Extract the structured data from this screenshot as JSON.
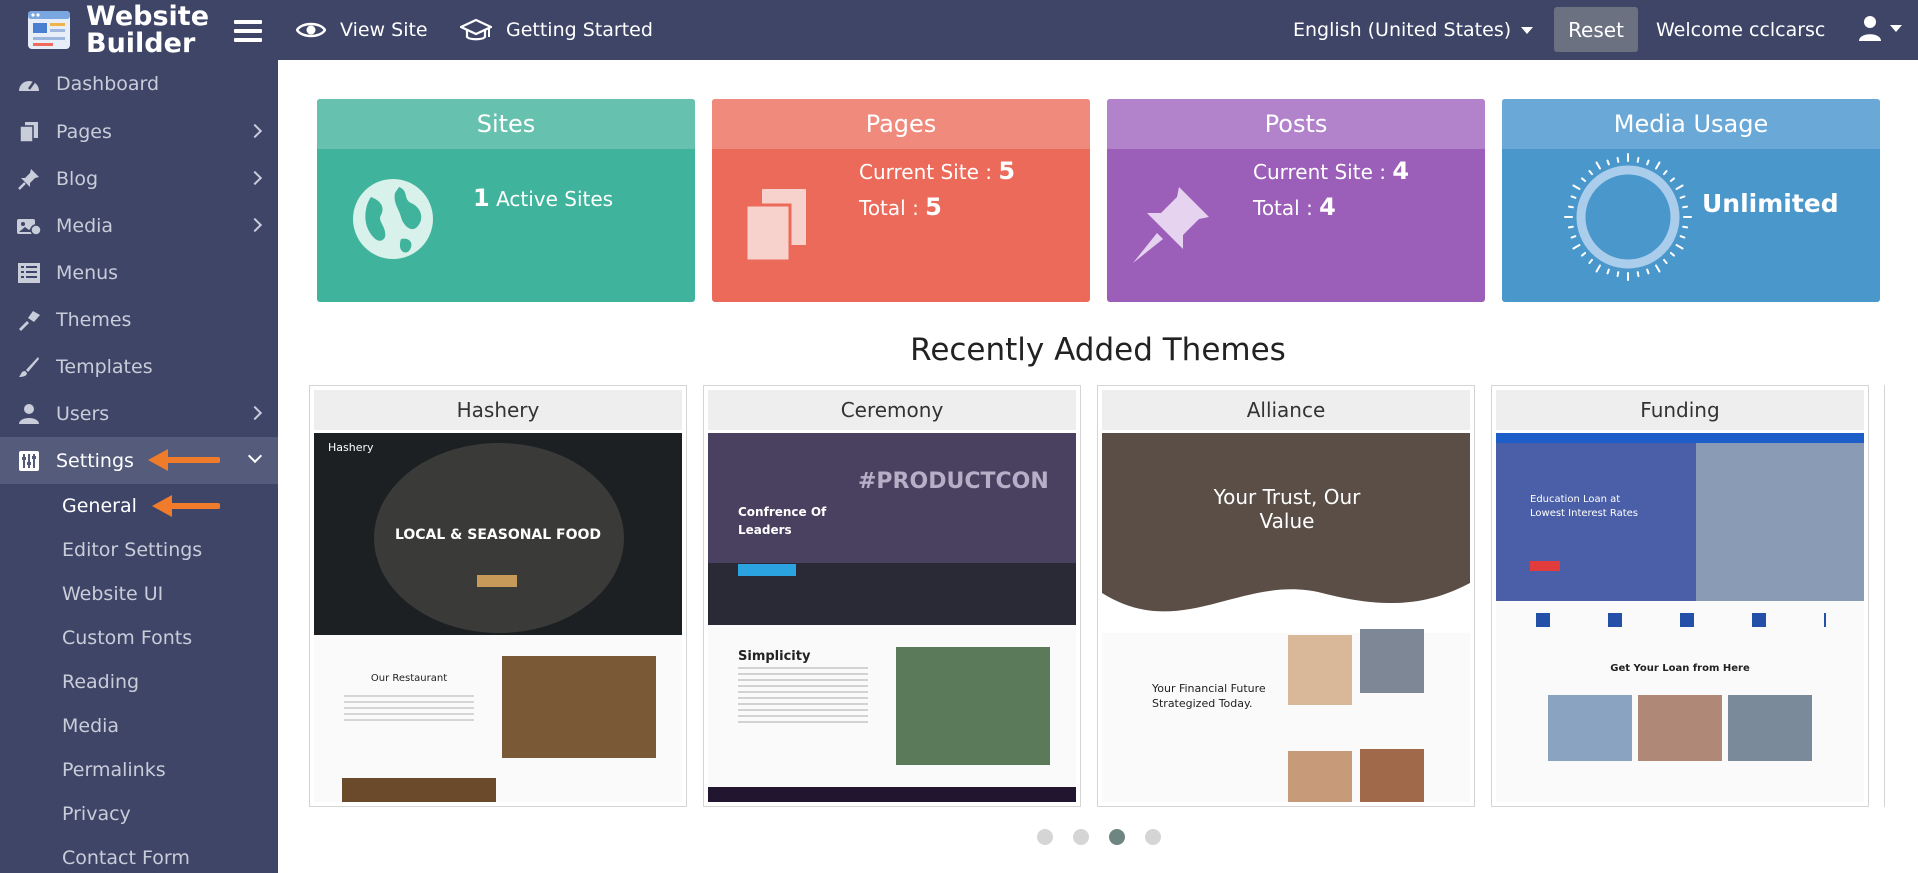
{
  "brand": {
    "line1": "Website",
    "line2": "Builder"
  },
  "topnav": {
    "view_site": "View Site",
    "getting_started": "Getting Started",
    "language": "English (United States)",
    "reset": "Reset",
    "welcome": "Welcome cclcarsc"
  },
  "sidebar": {
    "items": [
      {
        "label": "Dashboard",
        "icon": "dashboard-icon"
      },
      {
        "label": "Pages",
        "icon": "pages-icon"
      },
      {
        "label": "Blog",
        "icon": "pin-icon"
      },
      {
        "label": "Media",
        "icon": "media-icon"
      },
      {
        "label": "Menus",
        "icon": "menus-icon"
      },
      {
        "label": "Themes",
        "icon": "themes-icon"
      },
      {
        "label": "Templates",
        "icon": "brush-icon"
      },
      {
        "label": "Users",
        "icon": "user-icon"
      },
      {
        "label": "Settings",
        "icon": "settings-icon"
      }
    ],
    "settings_sub": [
      "General",
      "Editor Settings",
      "Website UI",
      "Custom Fonts",
      "Reading",
      "Media",
      "Permalinks",
      "Privacy",
      "Contact Form"
    ]
  },
  "stats": {
    "sites": {
      "title": "Sites",
      "count": "1",
      "label": "Active Sites",
      "color": "#3fb39b",
      "head": "#66c2ae"
    },
    "pages": {
      "title": "Pages",
      "current_label": "Current Site : ",
      "current": "5",
      "total_label": "Total : ",
      "total": "5",
      "color": "#ec6a5a",
      "head": "#f08a7c"
    },
    "posts": {
      "title": "Posts",
      "current_label": "Current Site : ",
      "current": "4",
      "total_label": "Total : ",
      "total": "4",
      "color": "#9c5fb9",
      "head": "#b283cb"
    },
    "media": {
      "title": "Media Usage",
      "value": "Unlimited",
      "color": "#4a97cc",
      "head": "#6aa9d7"
    }
  },
  "themes": {
    "title": "Recently Added Themes",
    "cards": [
      {
        "name": "Hashery",
        "tagline": "LOCAL & SEASONAL FOOD",
        "subtitle": "Our Restaurant"
      },
      {
        "name": "Ceremony",
        "tagline": "#PRODUCTCON",
        "subtitle": "Confrence Of Leaders",
        "extra": "Simplicity"
      },
      {
        "name": "Alliance",
        "tagline": "Your Trust, Our Value",
        "subtitle": "Your Financial Future Strategized Today."
      },
      {
        "name": "Funding",
        "tagline": "Education Loan at Lowest Interest Rates",
        "subtitle": "Get Your Loan from Here"
      }
    ],
    "carousel": {
      "total": 4,
      "active": 3
    }
  }
}
